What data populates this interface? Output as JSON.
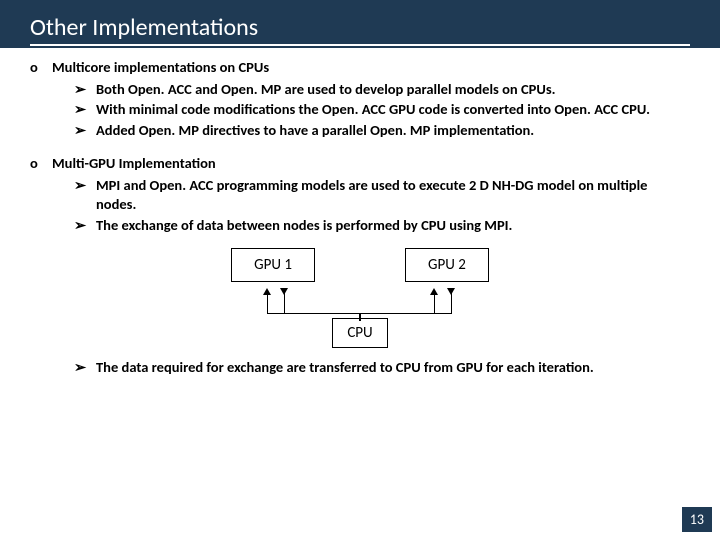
{
  "title": "Other Implementations",
  "section1": {
    "heading": "Multicore implementations on CPUs",
    "items": [
      "Both Open. ACC and Open. MP are used to develop parallel models on CPUs.",
      "With minimal code modifications the Open. ACC GPU code is converted into Open. ACC CPU.",
      "Added Open. MP directives to have a parallel Open. MP implementation."
    ]
  },
  "section2": {
    "heading": "Multi-GPU Implementation",
    "items": [
      "MPI and Open. ACC programming models are used to execute 2 D NH-DG model on multiple nodes.",
      "The exchange of data between nodes is performed by CPU using MPI."
    ],
    "footer": "The data required for exchange are transferred to CPU from GPU for each iteration."
  },
  "diagram": {
    "gpu1": "GPU 1",
    "gpu2": "GPU 2",
    "cpu": "CPU"
  },
  "page_number": "13",
  "bullets": {
    "circle": "o",
    "arrow": "➢"
  }
}
